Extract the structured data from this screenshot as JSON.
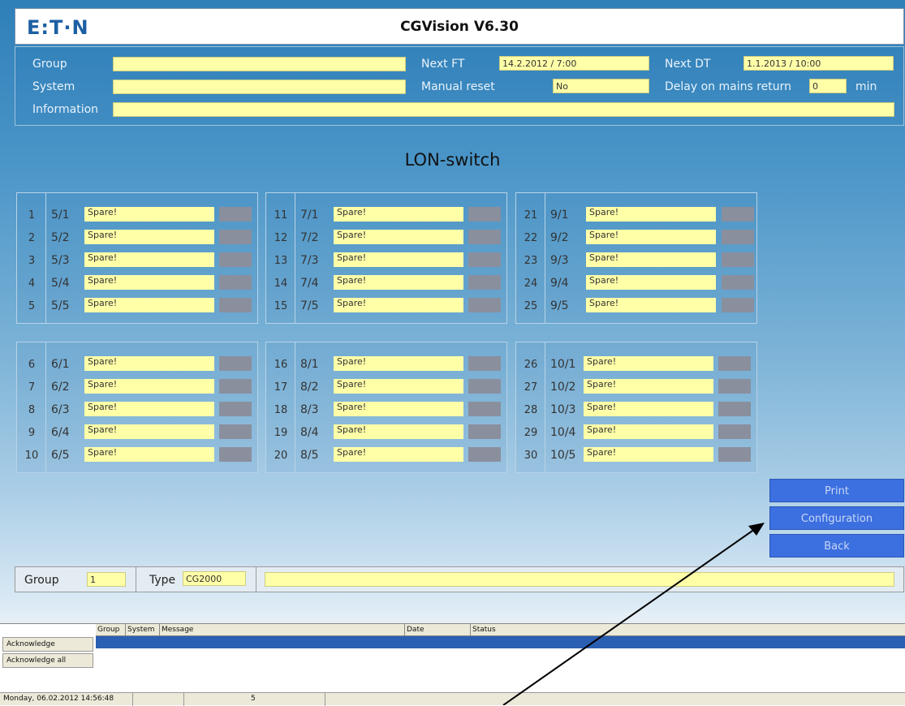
{
  "window": {
    "logo": "E:T·N",
    "title": "CGVision V6.30"
  },
  "header": {
    "group_label": "Group",
    "group_value": "",
    "system_label": "System",
    "system_value": "",
    "information_label": "Information",
    "information_value": "",
    "next_ft_label": "Next FT",
    "next_ft_value": "14.2.2012 / 7:00",
    "manual_reset_label": "Manual reset",
    "manual_reset_value": "No",
    "next_dt_label": "Next DT",
    "next_dt_value": "1.1.2013 / 10:00",
    "delay_label": "Delay on mains return",
    "delay_value": "0",
    "delay_unit": "min"
  },
  "page_heading": "LON-switch",
  "panels": [
    {
      "rows": [
        {
          "num": "1",
          "code": "5/1",
          "label": "Spare!"
        },
        {
          "num": "2",
          "code": "5/2",
          "label": "Spare!"
        },
        {
          "num": "3",
          "code": "5/3",
          "label": "Spare!"
        },
        {
          "num": "4",
          "code": "5/4",
          "label": "Spare!"
        },
        {
          "num": "5",
          "code": "5/5",
          "label": "Spare!"
        }
      ]
    },
    {
      "rows": [
        {
          "num": "11",
          "code": "7/1",
          "label": "Spare!"
        },
        {
          "num": "12",
          "code": "7/2",
          "label": "Spare!"
        },
        {
          "num": "13",
          "code": "7/3",
          "label": "Spare!"
        },
        {
          "num": "14",
          "code": "7/4",
          "label": "Spare!"
        },
        {
          "num": "15",
          "code": "7/5",
          "label": "Spare!"
        }
      ]
    },
    {
      "rows": [
        {
          "num": "21",
          "code": "9/1",
          "label": "Spare!"
        },
        {
          "num": "22",
          "code": "9/2",
          "label": "Spare!"
        },
        {
          "num": "23",
          "code": "9/3",
          "label": "Spare!"
        },
        {
          "num": "24",
          "code": "9/4",
          "label": "Spare!"
        },
        {
          "num": "25",
          "code": "9/5",
          "label": "Spare!"
        }
      ]
    },
    {
      "rows": [
        {
          "num": "6",
          "code": "6/1",
          "label": "Spare!"
        },
        {
          "num": "7",
          "code": "6/2",
          "label": "Spare!"
        },
        {
          "num": "8",
          "code": "6/3",
          "label": "Spare!"
        },
        {
          "num": "9",
          "code": "6/4",
          "label": "Spare!"
        },
        {
          "num": "10",
          "code": "6/5",
          "label": "Spare!"
        }
      ]
    },
    {
      "rows": [
        {
          "num": "16",
          "code": "8/1",
          "label": "Spare!"
        },
        {
          "num": "17",
          "code": "8/2",
          "label": "Spare!"
        },
        {
          "num": "18",
          "code": "8/3",
          "label": "Spare!"
        },
        {
          "num": "19",
          "code": "8/4",
          "label": "Spare!"
        },
        {
          "num": "20",
          "code": "8/5",
          "label": "Spare!"
        }
      ]
    },
    {
      "rows": [
        {
          "num": "26",
          "code": "10/1",
          "label": "Spare!"
        },
        {
          "num": "27",
          "code": "10/2",
          "label": "Spare!"
        },
        {
          "num": "28",
          "code": "10/3",
          "label": "Spare!"
        },
        {
          "num": "29",
          "code": "10/4",
          "label": "Spare!"
        },
        {
          "num": "30",
          "code": "10/5",
          "label": "Spare!"
        }
      ]
    }
  ],
  "buttons": {
    "print": "Print",
    "configuration": "Configuration",
    "back": "Back"
  },
  "groupbar": {
    "group_label": "Group",
    "group_value": "1",
    "type_label": "Type",
    "type_value": "CG2000",
    "description_value": ""
  },
  "messages": {
    "columns": [
      "Group",
      "System",
      "Message",
      "Date",
      "Status"
    ],
    "acknowledge": "Acknowledge",
    "acknowledge_all": "Acknowledge all"
  },
  "statusbar": {
    "datetime": "Monday, 06.02.2012 14:56:48",
    "count": "5"
  },
  "colors": {
    "field_yellow": "#ffffa8",
    "button_blue": "#3c6fe0",
    "indicator_grey": "#8a8f9e",
    "selection_blue": "#2b5fb2"
  }
}
